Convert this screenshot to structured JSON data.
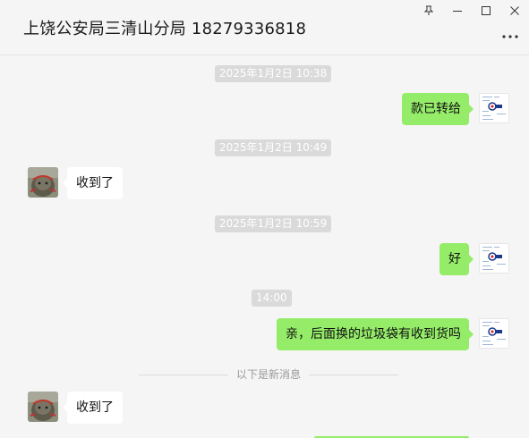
{
  "window": {
    "title": "上饶公安局三清山分局 18279336818"
  },
  "icons": {
    "pin": "pin-icon",
    "minimize": "minimize-icon",
    "maximize": "maximize-icon",
    "close": "close-icon",
    "more": "more-icon"
  },
  "messages": [
    {
      "type": "time",
      "text": "2025年1月2日 10:38"
    },
    {
      "type": "msg",
      "side": "right",
      "text": "款已转给"
    },
    {
      "type": "time",
      "text": "2025年1月2日 10:49"
    },
    {
      "type": "msg",
      "side": "left",
      "text": "收到了"
    },
    {
      "type": "time",
      "text": "2025年1月2日 10:59"
    },
    {
      "type": "msg",
      "side": "right",
      "text": "好"
    },
    {
      "type": "time",
      "text": "14:00"
    },
    {
      "type": "msg",
      "side": "right",
      "text": "亲，后面换的垃圾袋有收到货吗"
    },
    {
      "type": "divider",
      "text": "以下是新消息"
    },
    {
      "type": "msg",
      "side": "left",
      "text": "收到了"
    }
  ],
  "colors": {
    "self_bubble": "#95ec69",
    "other_bubble": "#ffffff",
    "background": "#f5f5f5",
    "timestamp_bg": "#dadada"
  }
}
